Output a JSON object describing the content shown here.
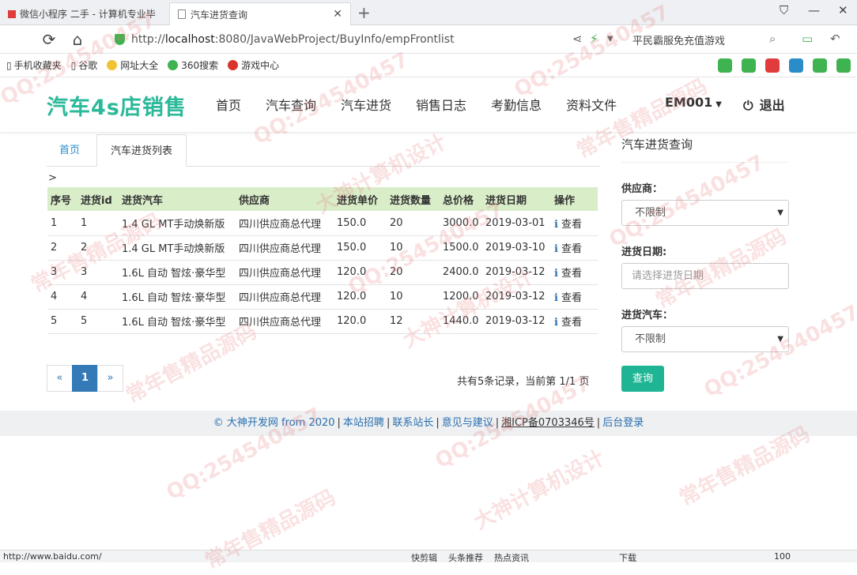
{
  "browser": {
    "tabs": [
      {
        "label": "微信小程序 二手 - 计算机专业毕"
      },
      {
        "label": "汽车进货查询"
      }
    ],
    "url_prefix": "http://",
    "url_host": "localhost",
    "url_rest": ":8080/JavaWebProject/BuyInfo/empFrontlist",
    "addr_right_text": "平民霸服免充值游戏",
    "bookmarks": [
      "手机收藏夹",
      "谷歌",
      "网址大全",
      "360搜索",
      "游戏中心"
    ],
    "status_url": "http://www.baidu.com/",
    "status_items": [
      "快剪辑",
      "头条推荐",
      "热点资讯",
      "下载",
      "100"
    ]
  },
  "navbar": {
    "brand": "汽车4s店销售",
    "menu": [
      "首页",
      "汽车查询",
      "汽车进货",
      "销售日志",
      "考勤信息",
      "资料文件"
    ],
    "user": "EM001",
    "logout": "退出"
  },
  "breadcrumb": {
    "home": "首页",
    "active": "汽车进货列表",
    "marker": ">"
  },
  "table": {
    "columns": [
      "序号",
      "进货id",
      "进货汽车",
      "供应商",
      "进货单价",
      "进货数量",
      "总价格",
      "进货日期",
      "操作"
    ],
    "rows": [
      [
        "1",
        "1",
        "1.4 GL MT手动焕新版",
        "四川供应商总代理",
        "150.0",
        "20",
        "3000.0",
        "2019-03-01",
        "查看"
      ],
      [
        "2",
        "2",
        "1.4 GL MT手动焕新版",
        "四川供应商总代理",
        "150.0",
        "10",
        "1500.0",
        "2019-03-10",
        "查看"
      ],
      [
        "3",
        "3",
        "1.6L 自动 智炫·豪华型",
        "四川供应商总代理",
        "120.0",
        "20",
        "2400.0",
        "2019-03-12",
        "查看"
      ],
      [
        "4",
        "4",
        "1.6L 自动 智炫·豪华型",
        "四川供应商总代理",
        "120.0",
        "10",
        "1200.0",
        "2019-03-12",
        "查看"
      ],
      [
        "5",
        "5",
        "1.6L 自动 智炫·豪华型",
        "四川供应商总代理",
        "120.0",
        "12",
        "1440.0",
        "2019-03-12",
        "查看"
      ]
    ]
  },
  "pager": {
    "prev": "«",
    "current": "1",
    "next": "»",
    "summary": "共有5条记录，当前第 1/1 页"
  },
  "sidebar": {
    "title": "汽车进货查询",
    "supplier_label": "供应商：",
    "supplier_value": "不限制",
    "date_label": "进货日期:",
    "date_placeholder": "请选择进货日期",
    "car_label": "进货汽车：",
    "car_value": "不限制",
    "query_button": "查询"
  },
  "footer": {
    "copyright": "© 大神开发网 from 2020",
    "links": [
      "本站招聘",
      "联系站长",
      "意见与建议"
    ],
    "icp": "湘ICP备0703346号",
    "admin": "后台登录"
  },
  "watermarks": [
    "QQ:254540457",
    "大神计算机设计",
    "常年售精品源码"
  ],
  "colors": {
    "brand": "#2bb999",
    "table_header": "#d9edc9",
    "link": "#2a6fae",
    "pager_active": "#337ab7",
    "query_button": "#1fb594"
  }
}
